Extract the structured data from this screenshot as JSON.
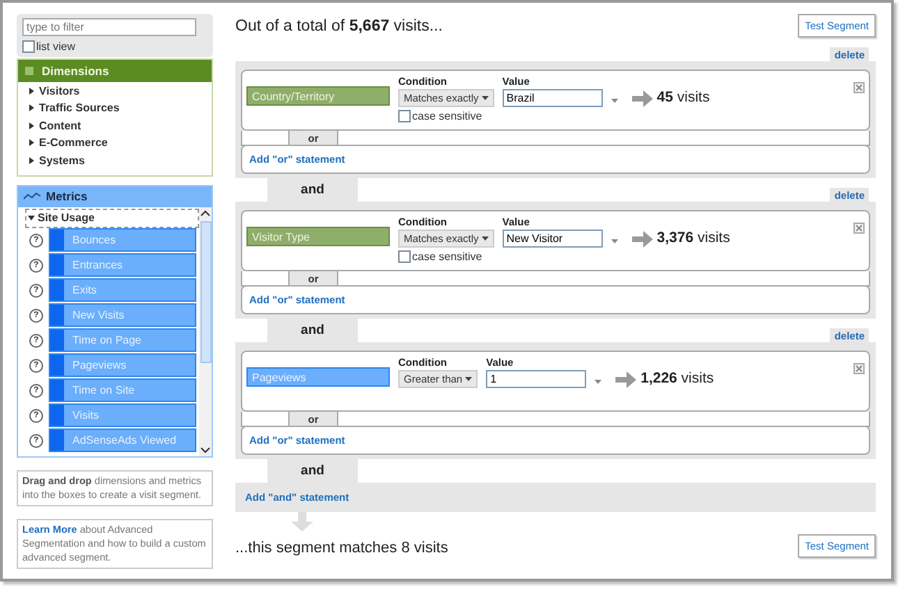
{
  "filter": {
    "placeholder": "type to filter"
  },
  "list_view": {
    "label": "list view",
    "checked": false
  },
  "dimensions": {
    "title": "Dimensions",
    "items": [
      {
        "label": "Visitors",
        "expanded": false
      },
      {
        "label": "Traffic Sources",
        "expanded": false
      },
      {
        "label": "Content",
        "expanded": false
      },
      {
        "label": "E-Commerce",
        "expanded": false
      },
      {
        "label": "Systems",
        "expanded": false
      }
    ]
  },
  "metrics": {
    "title": "Metrics",
    "group": {
      "label": "Site Usage",
      "expanded": true
    },
    "help_symbol": "?",
    "items": [
      "Bounces",
      "Entrances",
      "Exits",
      "New Visits",
      "Time on Page",
      "Pageviews",
      "Time on Site",
      "Visits",
      "AdSenseAds Viewed"
    ]
  },
  "hint": "**Drag and drop** dimensions and metrics into the boxes to create a visit segment.",
  "learn_more": {
    "link": "Learn More",
    "text": "about Advanced Segmentation and how to build a custom advanced segment."
  },
  "heading": "Out of a total of **5,667** visits...",
  "test_button_top": "Test Segment",
  "statements": [
    {
      "kind": "dimension",
      "field": "Country/Territory",
      "condition_label": "Condition",
      "condition": "Matches exactly",
      "value_label": "Value",
      "value": "Brazil",
      "case_sensitive": {
        "label": "case sensitive",
        "checked": false
      },
      "result": "**45** visits",
      "or_label": "or",
      "add_or": "Add \"or\" statement",
      "delete": "delete"
    },
    {
      "kind": "dimension",
      "and_label": "and",
      "field": "Visitor Type",
      "condition_label": "Condition",
      "condition": "Matches exactly",
      "value_label": "Value",
      "value": "New Visitor",
      "case_sensitive": {
        "label": "case sensitive",
        "checked": false
      },
      "result": "**3,376** visits",
      "or_label": "or",
      "add_or": "Add \"or\" statement",
      "delete": "delete"
    },
    {
      "kind": "metric",
      "and_label": "and",
      "field": "Pageviews",
      "condition_label": "Condition",
      "condition": "Greater than",
      "value_label": "Value",
      "value": "1",
      "result": "**1,226** visits",
      "or_label": "or",
      "add_or": "Add \"or\" statement",
      "delete": "delete"
    }
  ],
  "add_and": {
    "and_label": "and",
    "label": "Add \"and\" statement"
  },
  "footer": "...this segment matches 8 visits",
  "test_button_bottom": "Test Segment"
}
